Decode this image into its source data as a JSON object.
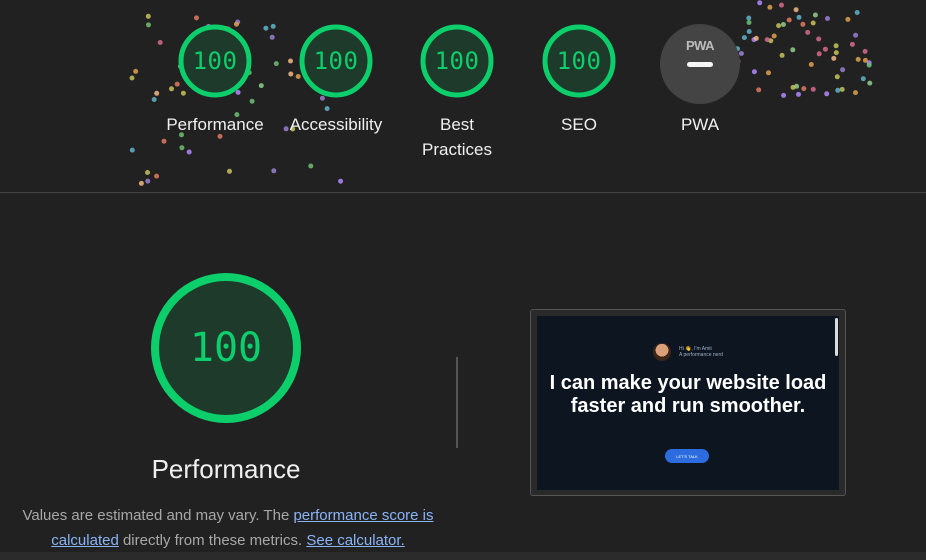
{
  "colors": {
    "background": "#212121",
    "pass_green": "#0cce6b",
    "pass_fill": "#1e3a2a",
    "pwa_badge": "#444444",
    "link": "#8ab4f8"
  },
  "summary_gauges": [
    {
      "score": "100",
      "label": "Performance"
    },
    {
      "score": "100",
      "label": "Accessibility"
    },
    {
      "score": "100",
      "label": "Best Practices"
    },
    {
      "score": "100",
      "label": "SEO"
    }
  ],
  "pwa": {
    "badge_text": "PWA",
    "label": "PWA"
  },
  "performance": {
    "score": "100",
    "title": "Performance",
    "desc_prefix": "Values are estimated and may vary. The ",
    "desc_link_1": "performance score is calculated",
    "desc_middle": " directly from these metrics. ",
    "desc_link_2": "See calculator."
  },
  "screenshot": {
    "intro_line_1": "Hi 👋, I'm Amit",
    "intro_line_2": "A performance nerd",
    "heading": "I can make your website load faster and run smoother.",
    "button_label": "LET'S TALK"
  }
}
